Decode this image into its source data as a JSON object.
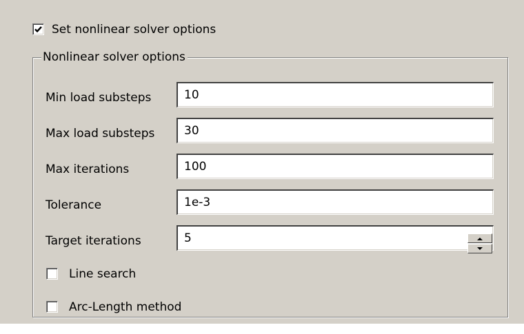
{
  "main_checkbox": {
    "label": "Set nonlinear solver options",
    "checked": true
  },
  "group": {
    "title": "Nonlinear solver options"
  },
  "fields": [
    {
      "label": "Min load substeps",
      "value": "10"
    },
    {
      "label": "Max load substeps",
      "value": "30"
    },
    {
      "label": "Max iterations",
      "value": "100"
    },
    {
      "label": "Tolerance",
      "value": "1e-3"
    },
    {
      "label": "Target iterations",
      "value": "5"
    }
  ],
  "options": [
    {
      "label": "Line search",
      "checked": false
    },
    {
      "label": "Arc-Length method",
      "checked": false
    }
  ],
  "icons": {
    "check": "checkmark-icon",
    "spin_up": "spin-up-arrow-icon",
    "spin_down": "spin-down-arrow-icon"
  }
}
